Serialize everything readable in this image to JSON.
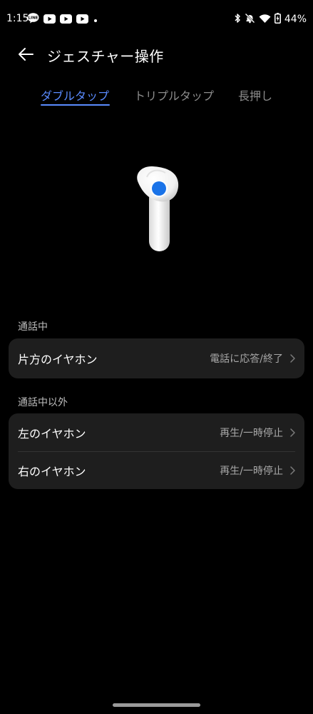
{
  "status_bar": {
    "time": "1:15",
    "battery": "44%",
    "left_icons": [
      "line-app-icon",
      "youtube-icon",
      "youtube-icon",
      "youtube-icon",
      "dot-icon"
    ],
    "right_icons": [
      "bluetooth-icon",
      "muted-bell-icon",
      "wifi-icon",
      "battery-icon"
    ]
  },
  "header": {
    "title": "ジェスチャー操作"
  },
  "tabs": [
    {
      "label": "ダブルタップ",
      "active": true
    },
    {
      "label": "トリプルタップ",
      "active": false
    },
    {
      "label": "長押し",
      "active": false
    }
  ],
  "sections": [
    {
      "label": "通話中",
      "rows": [
        {
          "label": "片方のイヤホン",
          "value": "電話に応答/終了"
        }
      ]
    },
    {
      "label": "通話中以外",
      "rows": [
        {
          "label": "左のイヤホン",
          "value": "再生/一時停止"
        },
        {
          "label": "右のイヤホン",
          "value": "再生/一時停止"
        }
      ]
    }
  ],
  "colors": {
    "accent": "#5a8bff",
    "card_background": "#1e1e1e",
    "earbud_dot": "#1a73e8"
  }
}
